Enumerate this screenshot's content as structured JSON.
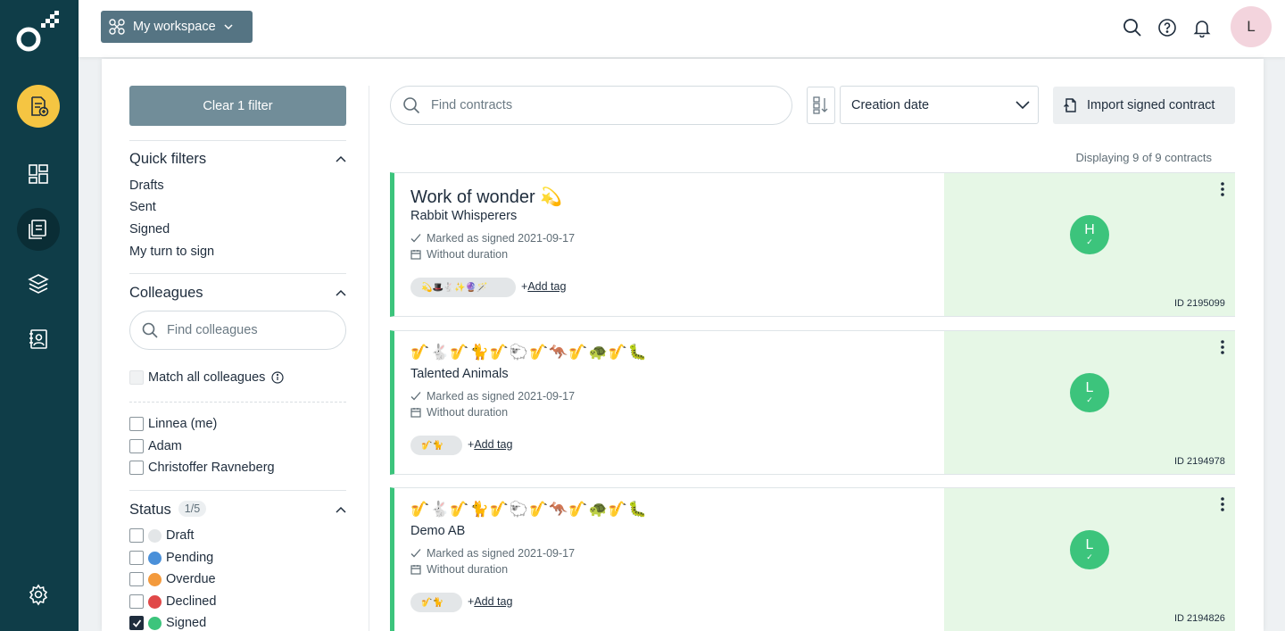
{
  "rail": {
    "items": [
      {
        "name": "new-contract-icon"
      },
      {
        "name": "dashboard-icon"
      },
      {
        "name": "contracts-icon"
      },
      {
        "name": "templates-icon"
      },
      {
        "name": "contacts-icon"
      },
      {
        "name": "settings-icon"
      }
    ]
  },
  "header": {
    "workspace_label": "My workspace",
    "avatar_initial": "L"
  },
  "filters": {
    "clear_label": "Clear 1 filter",
    "quick_title": "Quick filters",
    "quick": [
      "Drafts",
      "Sent",
      "Signed",
      "My turn to sign"
    ],
    "colleagues_title": "Colleagues",
    "colleagues_placeholder": "Find colleagues",
    "match_all_label": "Match all colleagues",
    "colleagues": [
      "Linnea (me)",
      "Adam",
      "Christoffer Ravneberg"
    ],
    "status_title": "Status",
    "status_count": "1/5",
    "statuses": [
      {
        "label": "Draft",
        "color": "#e3e6e8",
        "checked": false
      },
      {
        "label": "Pending",
        "color": "#4a90d9",
        "checked": false
      },
      {
        "label": "Overdue",
        "color": "#f39a3d",
        "checked": false
      },
      {
        "label": "Declined",
        "color": "#e04848",
        "checked": false
      },
      {
        "label": "Signed",
        "color": "#3cc47c",
        "checked": true
      }
    ]
  },
  "toolbar": {
    "search_placeholder": "Find contracts",
    "sort_label": "Creation date",
    "import_label": "Import signed contract",
    "displaying": "Displaying 9 of 9 contracts"
  },
  "contracts": [
    {
      "title": "Work of wonder 💫",
      "party": "Rabbit Whisperers",
      "status": "Marked as signed 2021-09-17",
      "duration": "Without duration",
      "tag": "💫🎩🐇✨🔮🪄",
      "add_tag": "Add tag",
      "avatar": "H",
      "id": "ID 2195099"
    },
    {
      "title": "🎷🐇🎷🐈🎷🐑🎷🦘🎷🐢🎷🐛",
      "party": "Talented Animals",
      "status": "Marked as signed 2021-09-17",
      "duration": "Without duration",
      "tag": "🎷🐈",
      "add_tag": "Add tag",
      "avatar": "L",
      "id": "ID 2194978"
    },
    {
      "title": "🎷🐇🎷🐈🎷🐑🎷🦘🎷🐢🎷🐛",
      "party": "Demo AB",
      "status": "Marked as signed 2021-09-17",
      "duration": "Without duration",
      "tag": "🎷🐈",
      "add_tag": "Add tag",
      "avatar": "L",
      "id": "ID 2194826"
    }
  ],
  "colors": {
    "rail": "#0f3d48",
    "accent": "#f5c542",
    "signed": "#3cc47c",
    "workspace_btn": "#557483"
  }
}
